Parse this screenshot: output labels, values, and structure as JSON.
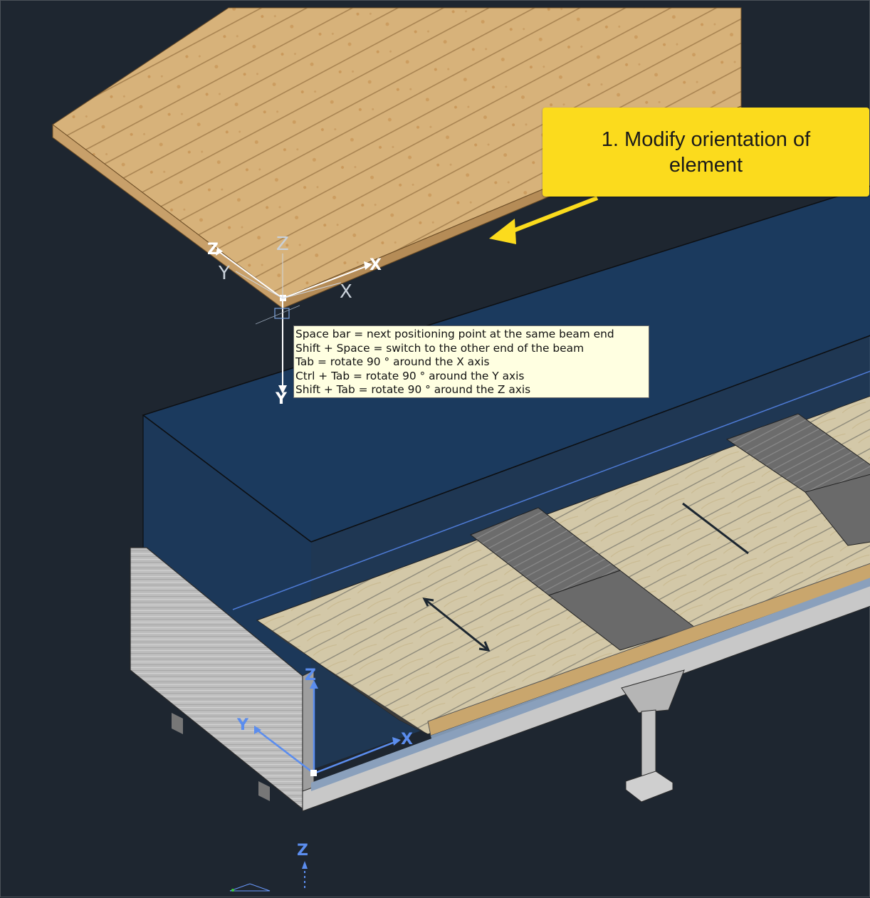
{
  "callout": {
    "text": "1. Modify orientation of element"
  },
  "tooltip": {
    "lines": [
      "Space bar = next positioning point at the same beam end",
      "Shift + Space = switch to the other end of the beam",
      "Tab = rotate 90 ° around the X axis",
      "Ctrl + Tab = rotate 90 ° around the Y axis",
      "Shift + Tab = rotate 90 ° around the Z axis"
    ]
  },
  "element_ucs": {
    "z_label": "Z",
    "y_label": "Y",
    "x_label": "X",
    "ghost_z_label": "Z",
    "ghost_y_label": "Y",
    "ghost_x_label": "X"
  },
  "world_ucs": {
    "z_label": "Z",
    "y_label": "Y",
    "x_label": "X"
  },
  "bottom_ucs": {
    "z_label": "Z"
  },
  "colors": {
    "background": "#1e2630",
    "callout": "#fbdb1d",
    "callout_arrow": "#fbdb1d",
    "tooltip_bg": "#ffffe1",
    "ucs_world": "#5b8dee",
    "ucs_element": "#ffffff",
    "volume": "#1c3b5e"
  },
  "icons": {
    "element_ucs": "ucs-axes-icon",
    "world_ucs": "ucs-axes-icon",
    "pointer_arrow": "callout-arrow-icon"
  }
}
